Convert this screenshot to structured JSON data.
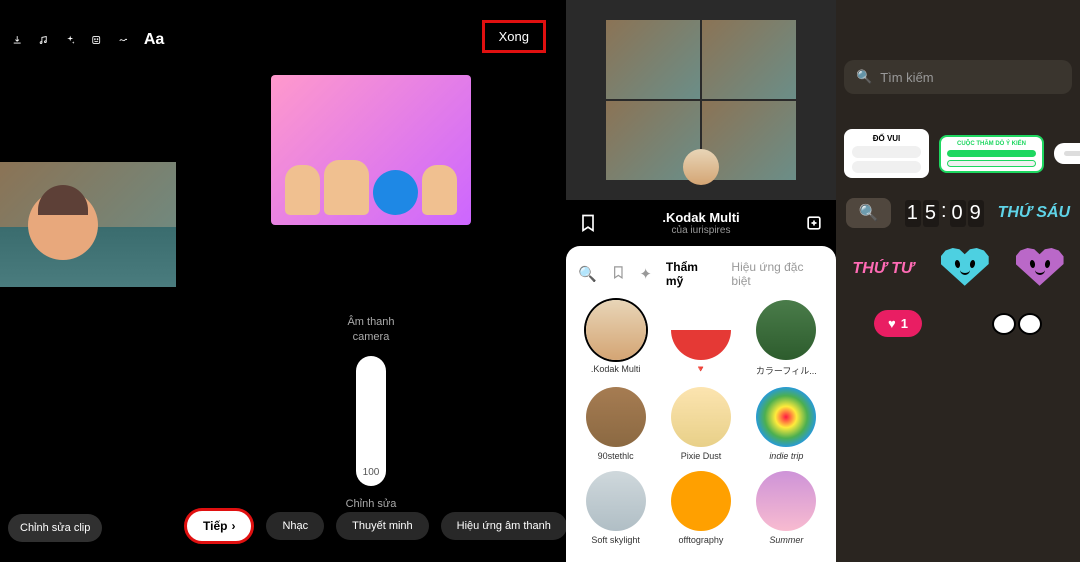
{
  "panel1": {
    "edit_clip": "Chỉnh sửa clip",
    "icons": [
      "download-icon",
      "music-icon",
      "sparkle-icon",
      "sticker-icon",
      "draw-icon",
      "text-icon"
    ],
    "text_label": "Aa"
  },
  "panel2": {
    "done": "Xong",
    "audio_title": "Âm thanh\ncamera",
    "slider_value": "100",
    "edit_label": "Chỉnh sửa",
    "next": "Tiếp",
    "tabs": [
      "Nhạc",
      "Thuyết minh",
      "Hiệu ứng âm thanh"
    ]
  },
  "panel3": {
    "effect_name": ".Kodak Multi",
    "effect_author": "của iurispires",
    "tabs": {
      "aesthetic": "Thẩm mỹ",
      "special": "Hiệu ứng đặc biệt"
    },
    "effects": [
      {
        "name": ".Kodak Multi",
        "color": "linear-gradient(#e8d5b7, #d4a574)"
      },
      {
        "name": "🔻",
        "color": "linear-gradient(#fff 50%, #e53935 50%)"
      },
      {
        "name": "カラーフィル...",
        "color": "linear-gradient(#4a7c4a, #2d5c2d)"
      },
      {
        "name": "90stethlc",
        "color": "linear-gradient(#a67c52, #8b6942)"
      },
      {
        "name": "Pixie Dust",
        "color": "linear-gradient(#fce4b0, #e8d088)"
      },
      {
        "name": "indie trip",
        "color": "radial-gradient(circle, #ff1744, #ffeb3b, #4caf50, #2196f3, #9c27b0)"
      },
      {
        "name": "Soft skylight",
        "color": "linear-gradient(#cfd8dc, #b0bec5)"
      },
      {
        "name": "offtography",
        "color": "#ffa000"
      },
      {
        "name": "Summer",
        "color": "linear-gradient(#ce93d8, #f8bbd0)"
      }
    ]
  },
  "panel4": {
    "search_placeholder": "Tìm kiếm",
    "quiz_label": "ĐỐ VUI",
    "poll_label": "CUỘC THĂM DÒ Ý KIẾN",
    "time": "15:09",
    "day1": "THỨ SÁU",
    "day2": "THỨ TƯ",
    "like_count": "1"
  }
}
